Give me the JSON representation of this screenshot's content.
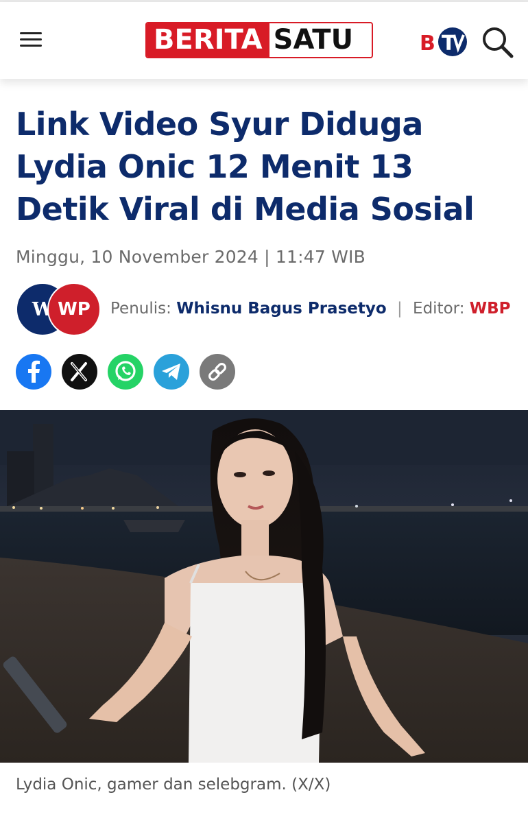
{
  "header": {
    "menu_icon": "hamburger-menu-icon",
    "logo_left": "BERITA",
    "logo_right": "SATU",
    "btv_logo": "BTV",
    "search_icon": "search-icon",
    "brand_color": "#d81b26"
  },
  "article": {
    "headline": "Link Video Syur Diduga Lydia Onic 12 Menit 13 Detik Viral di Media Sosial",
    "dateline": "Minggu, 10 November 2024 | 11:47 WIB",
    "avatars": [
      "W",
      "WP"
    ],
    "writer_label": "Penulis:",
    "writer_name": "Whisnu Bagus Prasetyo",
    "separator": "|",
    "editor_label": "Editor:",
    "editor_name": "WBP",
    "share_buttons": [
      {
        "icon": "facebook-icon",
        "color": "#1877f2"
      },
      {
        "icon": "x-icon",
        "color": "#111111"
      },
      {
        "icon": "whatsapp-icon",
        "color": "#25d366"
      },
      {
        "icon": "telegram-icon",
        "color": "#2aa1da"
      },
      {
        "icon": "link-icon",
        "color": "#7a7a7a"
      }
    ],
    "caption": "Lydia Onic, gamer dan selebgram. (X/X)",
    "headline_color": "#0d2b6b"
  }
}
